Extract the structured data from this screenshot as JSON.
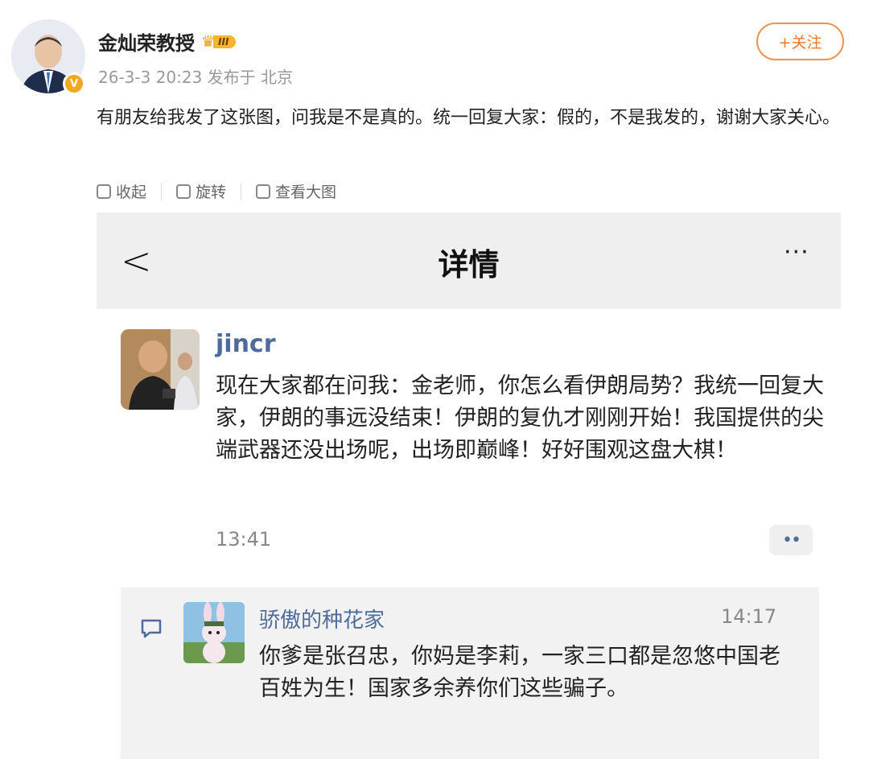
{
  "post": {
    "author_name": "金灿荣教授",
    "rank_level": "III",
    "verified_mark": "V",
    "meta": "26-3-3 20:23 发布于 北京",
    "follow_label": "+关注",
    "text": "有朋友给我发了这张图，问我是不是真的。统一回复大家：假的，不是我发的，谢谢大家关心。"
  },
  "toolbar": {
    "collapse_label": "收起",
    "rotate_label": "旋转",
    "view_large_label": "查看大图"
  },
  "screenshot": {
    "back_glyph": "<",
    "title": "详情",
    "more_glyph": "···",
    "user": "jincr",
    "text": "现在大家都在问我：金老师，你怎么看伊朗局势？我统一回复大家，伊朗的事远没结束！伊朗的复仇才刚刚开始！我国提供的尖端武器还没出场呢，出场即巅峰！好好围观这盘大棋！",
    "time": "13:41",
    "more_dots": "••",
    "comment": {
      "user": "骄傲的种花家",
      "time": "14:17",
      "text": "你爹是张召忠，你妈是李莉，一家三口都是忽悠中国老百姓为生！国家多余养你们这些骗子。"
    }
  },
  "colors": {
    "follow_orange": "#ec7a2c",
    "link_blue": "#4f6b9a",
    "verified_gold": "#f4a81d"
  }
}
